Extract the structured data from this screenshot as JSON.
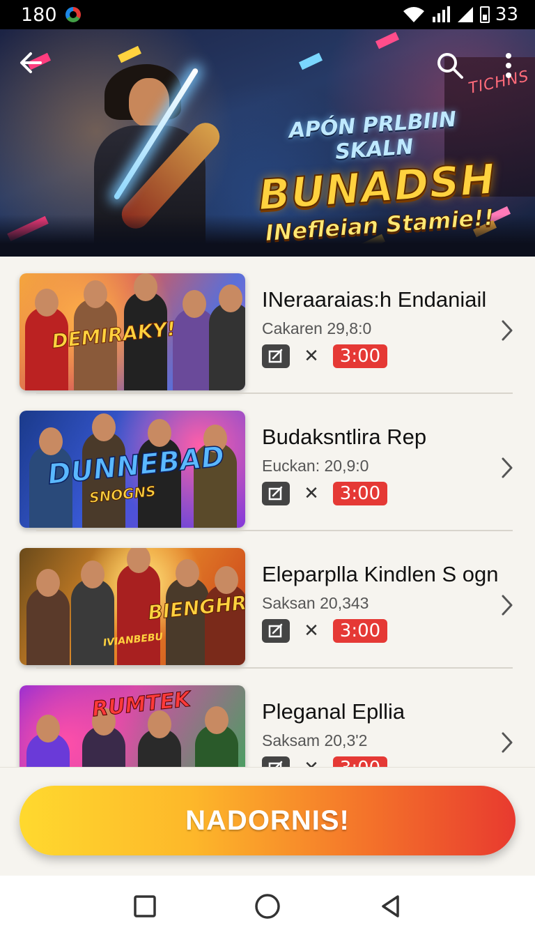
{
  "status_bar": {
    "time": "180",
    "battery_level": "33"
  },
  "hero": {
    "line1": "APÓN PRLBIIN SKALN",
    "line2": "BUNADSH",
    "line3": "INefleian Stamie!!",
    "sign": "TICHNS"
  },
  "icons": {
    "back": "arrow-left-icon",
    "search": "search-icon",
    "more": "more-vertical-icon",
    "edit": "edit-icon",
    "close": "close-icon",
    "chevron": "chevron-right-icon"
  },
  "items": [
    {
      "title": "INeraaraias:h Endaniail",
      "subtitle": "Cakaren 29,8:0",
      "time": "3:00",
      "thumb_logo": "DEMIRAKY!",
      "thumb_sublogo": ""
    },
    {
      "title": "Budaksntlira Rep",
      "subtitle": "Euckan: 20,9:0",
      "time": "3:00",
      "thumb_logo": "DUNNEBAD",
      "thumb_sublogo": "SNOGNS"
    },
    {
      "title": "Eleparplla Kindlen S ogn",
      "subtitle": "Saksan 20,343",
      "time": "3:00",
      "thumb_logo": "BIENGHRN",
      "thumb_sublogo": "IVIANBEBU"
    },
    {
      "title": "Pleganal Epllia",
      "subtitle": "Saksam 20,3'2",
      "time": "3:00",
      "thumb_logo": "RUMTEK",
      "thumb_sublogo": ""
    }
  ],
  "cta": {
    "label": "NADORNIS!"
  },
  "colors": {
    "accent_red": "#e53935",
    "cta_start": "#ffd92e",
    "cta_end": "#e83a2f"
  }
}
